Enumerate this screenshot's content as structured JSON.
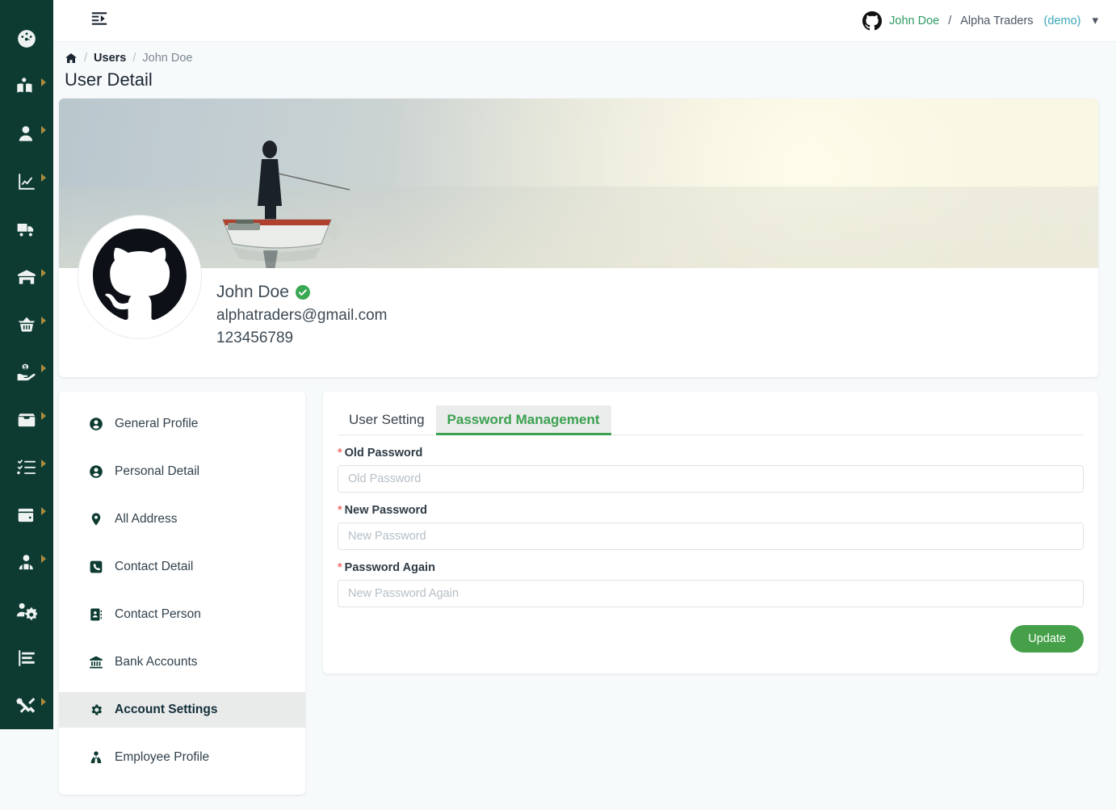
{
  "rail": {
    "items": [
      {
        "name": "dashboard",
        "icon": "gauge-icon",
        "caret": false
      },
      {
        "name": "catalog",
        "icon": "book-reader-icon",
        "caret": true
      },
      {
        "name": "customers",
        "icon": "user-icon",
        "caret": true
      },
      {
        "name": "analytics",
        "icon": "chart-line-icon",
        "caret": true
      },
      {
        "name": "shipping",
        "icon": "truck-icon",
        "caret": false
      },
      {
        "name": "warehouse",
        "icon": "warehouse-icon",
        "caret": true
      },
      {
        "name": "purchasing",
        "icon": "basket-icon",
        "caret": true
      },
      {
        "name": "finance",
        "icon": "hand-dollar-icon",
        "caret": true
      },
      {
        "name": "inbox",
        "icon": "archive-box-icon",
        "caret": true
      },
      {
        "name": "tasks",
        "icon": "task-list-icon",
        "caret": true
      },
      {
        "name": "payments",
        "icon": "wallet-icon",
        "caret": true
      },
      {
        "name": "users",
        "icon": "users-icon",
        "caret": true
      },
      {
        "name": "user-management",
        "icon": "users-cog-icon",
        "caret": false
      },
      {
        "name": "reports",
        "icon": "chart-bar-icon",
        "caret": false
      },
      {
        "name": "tools",
        "icon": "tools-icon",
        "caret": true
      }
    ]
  },
  "topbar": {
    "menu_toggle": "indent-collapse-icon",
    "user": {
      "avatar": "github-icon",
      "name": "John Doe",
      "separator": "/",
      "organization": "Alpha Traders",
      "environment": "(demo)",
      "chevron": "⌄"
    }
  },
  "breadcrumb": {
    "home_icon": "home-icon",
    "separator": "/",
    "items": [
      {
        "label": "Users",
        "current": false
      },
      {
        "label": "John Doe",
        "current": true
      }
    ]
  },
  "page": {
    "title": "User Detail"
  },
  "profile": {
    "banner_alt": "fisherman-on-boat-banner",
    "avatar_icon": "github-avatar",
    "name": "John Doe",
    "verified_badge": "verified-check-icon",
    "email": "alphatraders@gmail.com",
    "phone": "123456789"
  },
  "side_menu": {
    "items": [
      {
        "label": "General Profile",
        "icon": "user-circle-icon",
        "active": false
      },
      {
        "label": "Personal Detail",
        "icon": "user-circle-icon",
        "active": false
      },
      {
        "label": "All Address",
        "icon": "map-pin-icon",
        "active": false
      },
      {
        "label": "Contact Detail",
        "icon": "phone-square-icon",
        "active": false
      },
      {
        "label": "Contact Person",
        "icon": "address-book-icon",
        "active": false
      },
      {
        "label": "Bank Accounts",
        "icon": "bank-icon",
        "active": false
      },
      {
        "label": "Account Settings",
        "icon": "gear-icon",
        "active": true
      },
      {
        "label": "Employee Profile",
        "icon": "employee-tie-icon",
        "active": false
      }
    ]
  },
  "panel": {
    "tabs": [
      {
        "label": "User Setting",
        "active": false
      },
      {
        "label": "Password Management",
        "active": true
      }
    ],
    "fields": [
      {
        "label": "Old Password",
        "placeholder": "Old Password",
        "required": "*"
      },
      {
        "label": "New Password",
        "placeholder": "New Password",
        "required": "*"
      },
      {
        "label": "Password Again",
        "placeholder": "New Password Again",
        "required": "*"
      }
    ],
    "update_label": "Update"
  },
  "colors": {
    "rail_background": "#0d3b32",
    "accent_green": "#45a049",
    "tab_active_green": "#3aa14f",
    "required_red": "#f2706f",
    "page_background": "#f7fafb",
    "demo_teal": "#3aa6b9"
  }
}
